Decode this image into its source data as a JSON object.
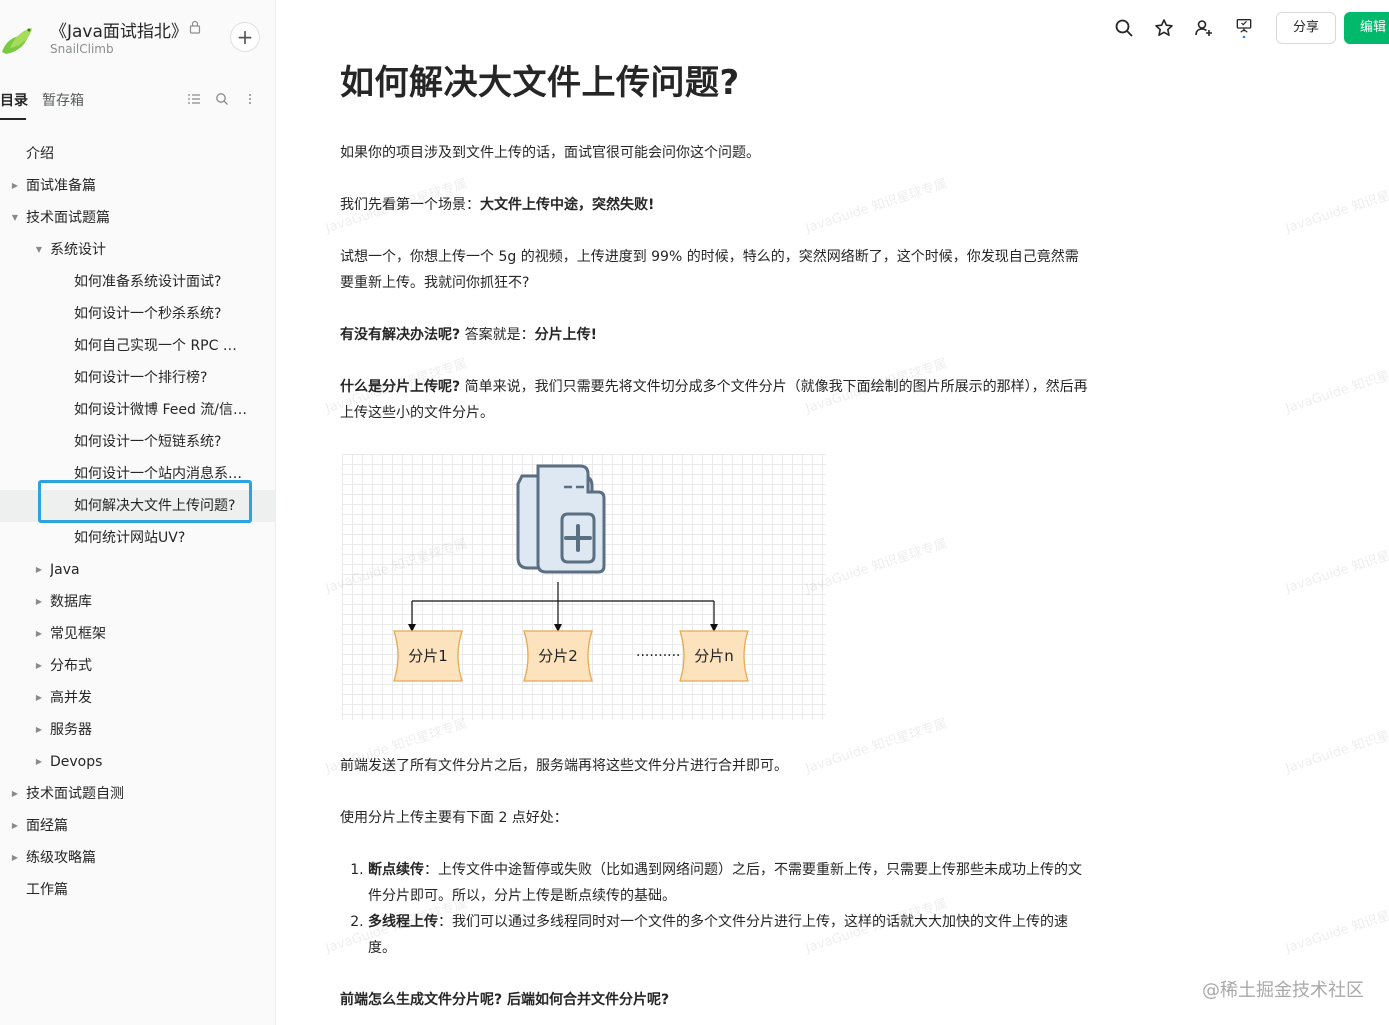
{
  "book": {
    "title": "《Java面试指北》",
    "subtitle": "SnailClimb",
    "add_label": "+"
  },
  "tabs": {
    "toc": "目录",
    "drafts": "暂存箱"
  },
  "toc": [
    {
      "label": "介绍",
      "level": 0,
      "caret": ""
    },
    {
      "label": "面试准备篇",
      "level": 0,
      "caret": "▶"
    },
    {
      "label": "技术面试题篇",
      "level": 0,
      "caret": "▼"
    },
    {
      "label": "系统设计",
      "level": 1,
      "caret": "▼"
    },
    {
      "label": "如何准备系统设计面试?",
      "level": 2,
      "caret": ""
    },
    {
      "label": "如何设计一个秒杀系统?",
      "level": 2,
      "caret": ""
    },
    {
      "label": "如何自己实现一个 RPC 框...",
      "level": 2,
      "caret": ""
    },
    {
      "label": "如何设计一个排行榜?",
      "level": 2,
      "caret": ""
    },
    {
      "label": "如何设计微博 Feed 流/信息...",
      "level": 2,
      "caret": ""
    },
    {
      "label": "如何设计一个短链系统?",
      "level": 2,
      "caret": ""
    },
    {
      "label": "如何设计一个站内消息系统...",
      "level": 2,
      "caret": ""
    },
    {
      "label": "如何解决大文件上传问题?",
      "level": 2,
      "caret": "",
      "selected": true
    },
    {
      "label": "如何统计网站UV?",
      "level": 2,
      "caret": ""
    },
    {
      "label": "Java",
      "level": 1,
      "caret": "▶"
    },
    {
      "label": "数据库",
      "level": 1,
      "caret": "▶"
    },
    {
      "label": "常见框架",
      "level": 1,
      "caret": "▶"
    },
    {
      "label": "分布式",
      "level": 1,
      "caret": "▶"
    },
    {
      "label": "高并发",
      "level": 1,
      "caret": "▶"
    },
    {
      "label": "服务器",
      "level": 1,
      "caret": "▶"
    },
    {
      "label": "Devops",
      "level": 1,
      "caret": "▶"
    },
    {
      "label": "技术面试题自测",
      "level": 0,
      "caret": "▶"
    },
    {
      "label": "面经篇",
      "level": 0,
      "caret": "▶"
    },
    {
      "label": "练级攻略篇",
      "level": 0,
      "caret": "▶"
    },
    {
      "label": "工作篇",
      "level": 0,
      "caret": ""
    }
  ],
  "toolbar": {
    "share_label": "分享",
    "edit_label": "编辑",
    "icons": [
      "search-icon",
      "star-icon",
      "add-collaborator-icon",
      "presentation-icon"
    ]
  },
  "article": {
    "title": "如何解决大文件上传问题?",
    "intro": "如果你的项目涉及到文件上传的话，面试官很可能会问你这个问题。",
    "scene_prefix": "我们先看第一个场景：",
    "scene_bold": "大文件上传中途，突然失败!",
    "imagine": "试想一个，你想上传一个 5g 的视频，上传进度到 99% 的时候，特么的，突然网络断了，这个时候，你发现自己竟然需要重新上传。我就问你抓狂不?",
    "solution_q": "有没有解决办法呢?",
    "solution_mid": "答案就是：",
    "solution_bold": "分片上传!",
    "what_q": "什么是分片上传呢?",
    "what_text": "简单来说，我们只需要先将文件切分成多个文件分片（就像我下面绘制的图片所展示的那样），然后再上传这些小的文件分片。",
    "after_figure": "前端发送了所有文件分片之后，服务端再将这些文件分片进行合并即可。",
    "benefits_intro": "使用分片上传主要有下面 2 点好处：",
    "benefits": [
      {
        "bold": "断点续传",
        "text": "：上传文件中途暂停或失败（比如遇到网络问题）之后，不需要重新上传，只需要上传那些未成功上传的文件分片即可。所以，分片上传是断点续传的基础。"
      },
      {
        "bold": "多线程上传",
        "text": "：我们可以通过多线程同时对一个文件的多个文件分片进行上传，这样的话就大大加快的文件上传的速度。"
      }
    ],
    "last_q": "前端怎么生成文件分片呢? 后端如何合并文件分片呢?"
  },
  "figure": {
    "chunks": [
      "分片1",
      "分片2",
      "分片n"
    ],
    "dots": "··········",
    "chunk_fill": "#fde3bd",
    "chunk_stroke": "#e8a84f",
    "doc_fill": "#dde8f2",
    "doc_stroke": "#5b6e82"
  },
  "watermark_text": "JavaGuide 知识星球专属",
  "credit": "@稀土掘金技术社区",
  "colors": {
    "accent": "#00b96b",
    "selection": "#2aa3e0"
  }
}
